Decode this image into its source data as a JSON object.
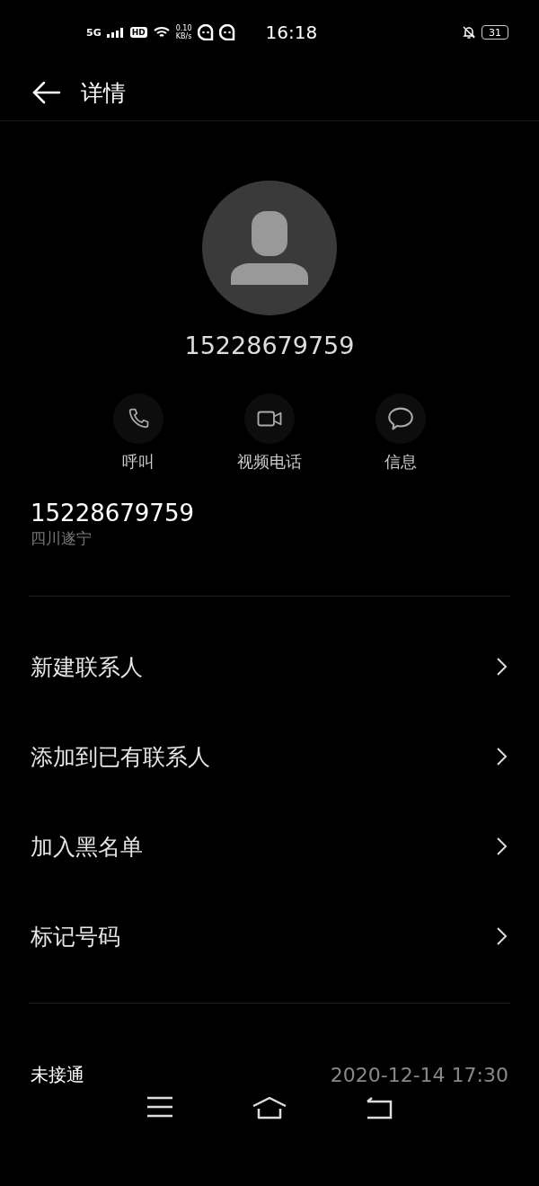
{
  "status_bar": {
    "network": "5G",
    "hd": "HD",
    "speed_value": "0.10",
    "speed_unit": "KB/s",
    "time": "16:18",
    "battery": "31"
  },
  "header": {
    "title": "详情"
  },
  "contact": {
    "number": "15228679759"
  },
  "actions": [
    {
      "kind": "call",
      "label": "呼叫"
    },
    {
      "kind": "video",
      "label": "视频电话"
    },
    {
      "kind": "message",
      "label": "信息"
    }
  ],
  "number_info": {
    "number": "15228679759",
    "location": "四川遂宁"
  },
  "menu": [
    {
      "label": "新建联系人"
    },
    {
      "label": "添加到已有联系人"
    },
    {
      "label": "加入黑名单"
    },
    {
      "label": "标记号码"
    }
  ],
  "call_log": [
    {
      "status": "未接通",
      "time": "2020-12-14 17:30"
    }
  ]
}
